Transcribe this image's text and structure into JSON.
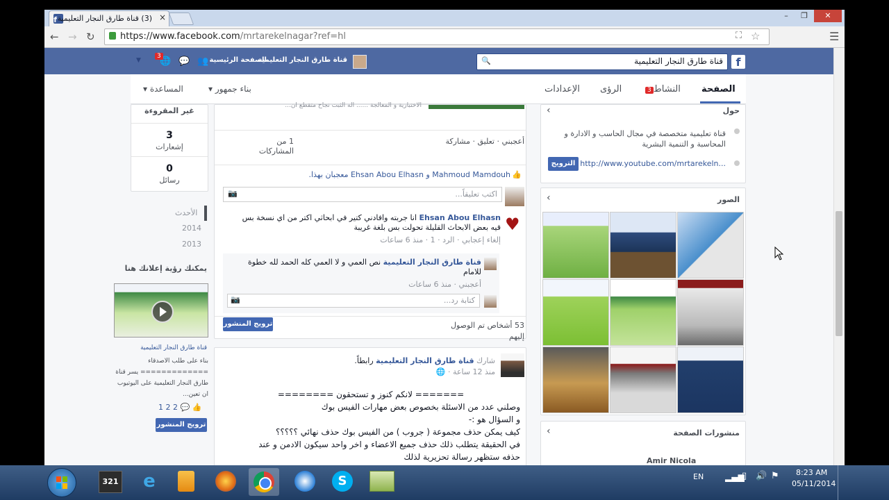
{
  "browser": {
    "tab_title": "(3) قناة طارق النجار التعليمية",
    "tab_close": "×",
    "url_host": "https://www.facebook.com",
    "url_path": "/mrtarekelnagar?ref=hl",
    "window_buttons": [
      "–",
      "❐",
      "✕"
    ]
  },
  "fb": {
    "logo": "f",
    "search_value": "قناة طارق النجار التعليمية",
    "nav": [
      "قناة طارق النجار التعليمية",
      "الصفحة الرئيسية"
    ],
    "notif_count": "3"
  },
  "page_tabs": {
    "timeline": "الصفحة",
    "activity": "النشاط",
    "activity_badge": "3",
    "insights": "الرؤى",
    "settings": "الإعدادات",
    "build_audience": "بناء جمهور",
    "help": "المساعدة"
  },
  "about": {
    "header": "حول",
    "description": "قناة تعليمية متخصصة في مجال الحاسب و الادارة و المحاسبة و التنمية البشرية",
    "website": "http://www.youtube.com/mrtarekeln...",
    "promote": "الترويج"
  },
  "photos": {
    "header": "الصور"
  },
  "page_posts": {
    "header": "منشورات الصفحة",
    "preview_name": "Amir Nicola"
  },
  "left_col": {
    "unread_label": "غير المقروءة",
    "notif_count": "3",
    "notif_label": "إشعارات",
    "msg_count": "0",
    "msg_label": "رسائل",
    "years": [
      "الأحدث",
      "2014",
      "2013"
    ],
    "ad_title": "يمكنك رؤية إعلانك هنا",
    "ad_page": "قناة طارق النجار التعليمية",
    "ad_text": "بناء على طلب الاصدقاء ============= يسر قناة طارق النجار التعليمية على اليوتيوب ان تعين...",
    "ad_stats": "1 2 2",
    "ad_button": "ترويج المنشور"
  },
  "post1": {
    "top_snippet": "الاختبارية و المعالجة ...... اله الثبت نجاح متقطع ان...",
    "actions": "أعجبني · تعليق · مشاركة",
    "shares": "1 من المشاركات",
    "likers": "Mahmoud Mamdouh و Ehsan Abou Elhasn معجبان بهذا.",
    "comment_placeholder": "اكتب تعليقاً...",
    "comment1_name": "Ehsan Abou Elhasn",
    "comment1_text": "انا جربته وافادني كتير في ابحاثي اكتر من اي نسخة بس قيه بعض الابحاث القليلة تحولت بس بلغة غريبة",
    "comment1_meta": "إلغاء إعجابي · الرد · 1 · منذ 6 ساعات",
    "reply_name": "قناة طارق النجار التعليمية",
    "reply_text": "نص العمي و لا العمي كله الحمد لله خطوة للامام",
    "reply_meta": "أعجبني · منذ 6 ساعات",
    "reply_placeholder": "كتابة رد...",
    "reach": "53 أشخاص تم الوصول إليهم",
    "boost": "ترويج المنشور"
  },
  "post2": {
    "author": "قناة طارق النجار التعليمية",
    "pre": "شارك",
    "post": "رابطاً.",
    "time": "منذ 12 ساعة",
    "lines": [
      "======= لانكم كنوز و تستحقون ========",
      "وصلني عدد من الاسئلة بخصوص بعض مهارات الفيس بوك",
      "و السؤال هو :-",
      "كيف يمكن حذف مجموعة ( جروب ) من الفيس بوك حذف نهائي ؟؟؟؟؟",
      "في الحقيقة يتطلب ذلك حذف جميع الاعضاء و اخر واحد سيكون الادمن و عند",
      "حذفه ستظهر رسالة تحزيرية لذلك"
    ]
  },
  "taskbar": {
    "lang": "EN",
    "time": "8:23 AM",
    "date": "05/11/2014"
  },
  "colors": {
    "fb_blue": "#4e69a2",
    "link": "#365899",
    "badge": "#e02a2a"
  }
}
